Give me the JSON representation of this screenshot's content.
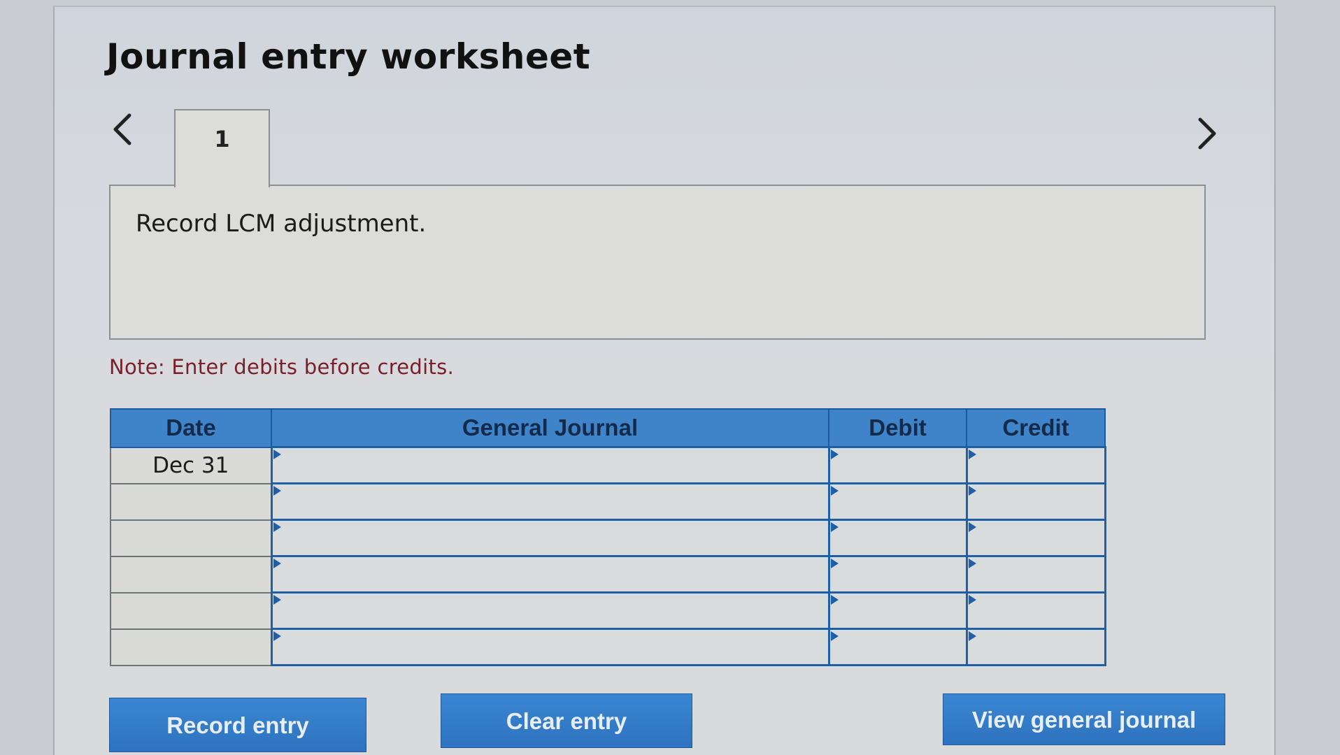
{
  "worksheet": {
    "title": "Journal entry worksheet",
    "tabs": [
      {
        "label": "1"
      }
    ],
    "instruction": "Record LCM adjustment.",
    "note": "Note: Enter debits before credits."
  },
  "journal": {
    "columns": {
      "date": "Date",
      "general_journal": "General Journal",
      "debit": "Debit",
      "credit": "Credit"
    },
    "rows": [
      {
        "date": "Dec 31",
        "account": "",
        "debit": "",
        "credit": ""
      },
      {
        "date": "",
        "account": "",
        "debit": "",
        "credit": ""
      },
      {
        "date": "",
        "account": "",
        "debit": "",
        "credit": ""
      },
      {
        "date": "",
        "account": "",
        "debit": "",
        "credit": ""
      },
      {
        "date": "",
        "account": "",
        "debit": "",
        "credit": ""
      },
      {
        "date": "",
        "account": "",
        "debit": "",
        "credit": ""
      }
    ]
  },
  "buttons": {
    "record": "Record entry",
    "clear": "Clear entry",
    "view": "View general journal"
  },
  "icons": {
    "prev": "chevron-left-icon",
    "next": "chevron-right-icon"
  },
  "colors": {
    "header_blue": "#3f84c9",
    "button_blue": "#2e73bf",
    "note_red": "#7a1f2a"
  }
}
